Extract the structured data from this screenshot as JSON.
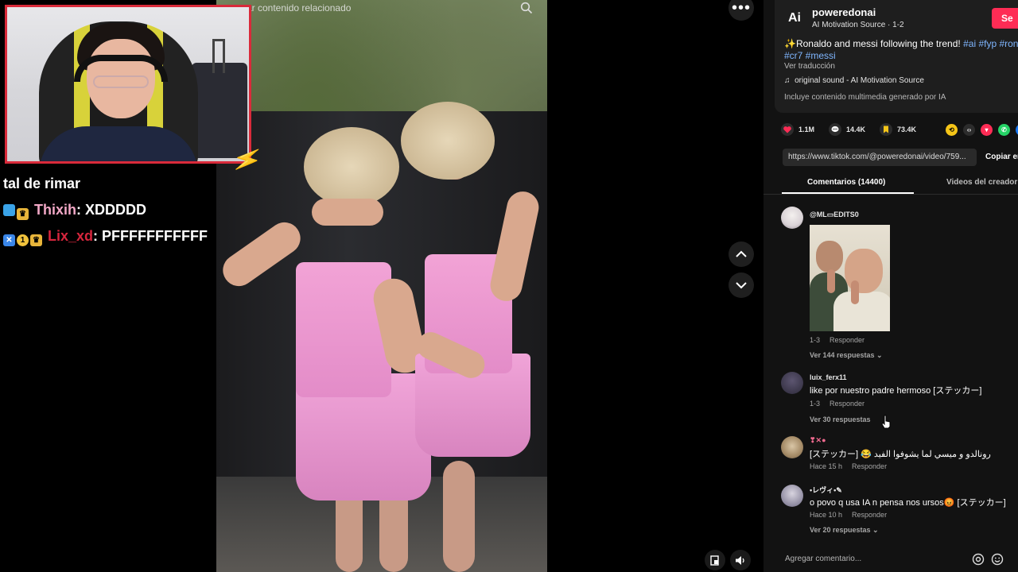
{
  "video": {
    "related_text": "ar contenido relacionado"
  },
  "chat": {
    "lines": [
      {
        "text": "tal de rimar"
      },
      {
        "user": "Thixih",
        "message": ": XDDDDD"
      },
      {
        "user": "Lix_xd",
        "message": ": PFFFFFFFFFFF"
      }
    ]
  },
  "author": {
    "logo": "Ai",
    "name": "poweredonai",
    "subtitle": "AI Motivation Source · 1-2",
    "follow_label": "Se"
  },
  "post": {
    "caption_text": "Ronaldo and messi following the trend!",
    "hashtags_line1": "#ai #fyp #rona",
    "hashtags_line2": "#cr7 #messi",
    "see_translation": "Ver traducción",
    "sound": "original sound - AI Motivation Source",
    "ai_note": "Incluye contenido multimedia generado por IA"
  },
  "stats": {
    "likes": "1.1M",
    "comments": "14.4K",
    "saves": "73.4K"
  },
  "link": {
    "url": "https://www.tiktok.com/@poweredonai/video/759...",
    "copy_label": "Copiar en"
  },
  "tabs": {
    "comments": "Comentarios (14400)",
    "creator_videos": "Videos del creador"
  },
  "comments": [
    {
      "user": "@ML▭EDITS0",
      "date": "1-3",
      "reply": "Responder",
      "replies": "Ver 144 respuestas ⌄"
    },
    {
      "user": "luix_ferx11",
      "text": "like por nuestro padre hermoso [ステッカー]",
      "date": "1-3",
      "reply": "Responder",
      "replies": "Ver 30 respuestas"
    },
    {
      "user": "❣✕●",
      "text": "[ステッカー] 😂 رونالدو و ميسي لما يشوفوا الفيد",
      "date": "Hace 15 h",
      "reply": "Responder"
    },
    {
      "user": "•レヴィ•✎",
      "text": "o povo q usa IA n pensa nos ursos😡 [ステッカー]",
      "date": "Hace 10 h",
      "reply": "Responder",
      "replies": "Ver 20 respuestas ⌄"
    }
  ],
  "comment_input": {
    "placeholder": "Agregar comentario..."
  },
  "colors": {
    "accent": "#fe2c55",
    "hashtag": "#7fb6ff",
    "webcam_border": "#d92a3a"
  }
}
